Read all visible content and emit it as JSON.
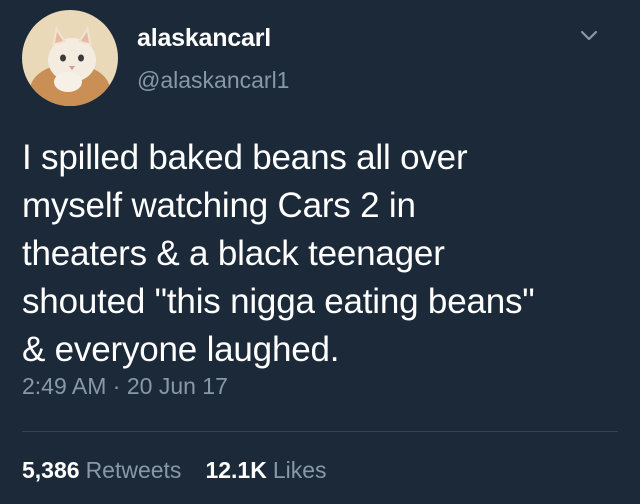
{
  "user": {
    "display_name": "alaskancarl",
    "handle": "@alaskancarl1",
    "avatar_icon": "cat-avatar"
  },
  "tweet": {
    "text": "I spilled baked beans all over\nmyself watching Cars 2 in\ntheaters & a black teenager\nshouted \"this nigga eating beans\"\n& everyone laughed.",
    "time": "2:49 AM",
    "separator": "·",
    "date": "20 Jun 17"
  },
  "stats": {
    "retweets_count": "5,386",
    "retweets_label": "Retweets",
    "likes_count": "12.1K",
    "likes_label": "Likes"
  },
  "theme": {
    "background": "#1c2938",
    "text": "#ffffff",
    "secondary": "#8899a6",
    "divider": "#38444d"
  }
}
